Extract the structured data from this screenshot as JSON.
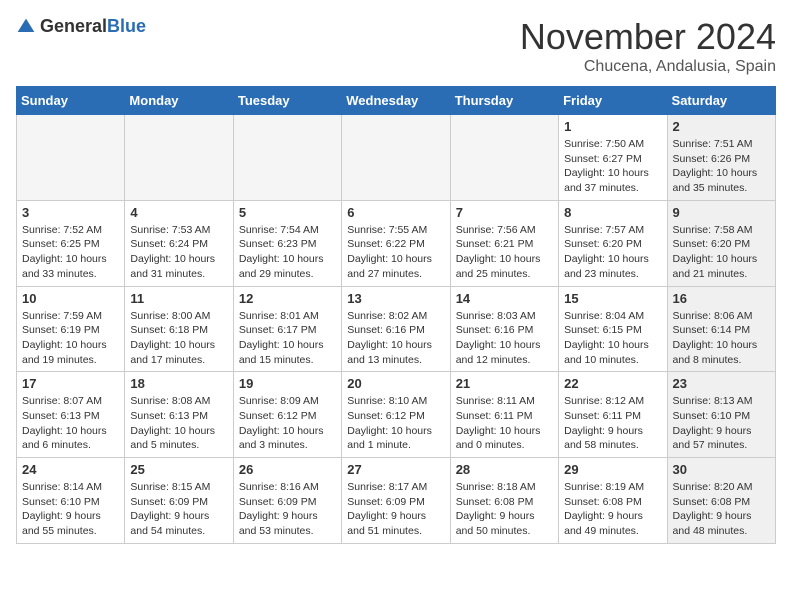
{
  "header": {
    "logo_general": "General",
    "logo_blue": "Blue",
    "month_title": "November 2024",
    "subtitle": "Chucena, Andalusia, Spain"
  },
  "days_of_week": [
    "Sunday",
    "Monday",
    "Tuesday",
    "Wednesday",
    "Thursday",
    "Friday",
    "Saturday"
  ],
  "weeks": [
    [
      {
        "day": "",
        "content": "",
        "empty": true
      },
      {
        "day": "",
        "content": "",
        "empty": true
      },
      {
        "day": "",
        "content": "",
        "empty": true
      },
      {
        "day": "",
        "content": "",
        "empty": true
      },
      {
        "day": "",
        "content": "",
        "empty": true
      },
      {
        "day": "1",
        "content": "Sunrise: 7:50 AM\nSunset: 6:27 PM\nDaylight: 10 hours and 37 minutes.",
        "empty": false,
        "shaded": false
      },
      {
        "day": "2",
        "content": "Sunrise: 7:51 AM\nSunset: 6:26 PM\nDaylight: 10 hours and 35 minutes.",
        "empty": false,
        "shaded": true
      }
    ],
    [
      {
        "day": "3",
        "content": "Sunrise: 7:52 AM\nSunset: 6:25 PM\nDaylight: 10 hours and 33 minutes.",
        "empty": false,
        "shaded": false
      },
      {
        "day": "4",
        "content": "Sunrise: 7:53 AM\nSunset: 6:24 PM\nDaylight: 10 hours and 31 minutes.",
        "empty": false,
        "shaded": false
      },
      {
        "day": "5",
        "content": "Sunrise: 7:54 AM\nSunset: 6:23 PM\nDaylight: 10 hours and 29 minutes.",
        "empty": false,
        "shaded": false
      },
      {
        "day": "6",
        "content": "Sunrise: 7:55 AM\nSunset: 6:22 PM\nDaylight: 10 hours and 27 minutes.",
        "empty": false,
        "shaded": false
      },
      {
        "day": "7",
        "content": "Sunrise: 7:56 AM\nSunset: 6:21 PM\nDaylight: 10 hours and 25 minutes.",
        "empty": false,
        "shaded": false
      },
      {
        "day": "8",
        "content": "Sunrise: 7:57 AM\nSunset: 6:20 PM\nDaylight: 10 hours and 23 minutes.",
        "empty": false,
        "shaded": false
      },
      {
        "day": "9",
        "content": "Sunrise: 7:58 AM\nSunset: 6:20 PM\nDaylight: 10 hours and 21 minutes.",
        "empty": false,
        "shaded": true
      }
    ],
    [
      {
        "day": "10",
        "content": "Sunrise: 7:59 AM\nSunset: 6:19 PM\nDaylight: 10 hours and 19 minutes.",
        "empty": false,
        "shaded": false
      },
      {
        "day": "11",
        "content": "Sunrise: 8:00 AM\nSunset: 6:18 PM\nDaylight: 10 hours and 17 minutes.",
        "empty": false,
        "shaded": false
      },
      {
        "day": "12",
        "content": "Sunrise: 8:01 AM\nSunset: 6:17 PM\nDaylight: 10 hours and 15 minutes.",
        "empty": false,
        "shaded": false
      },
      {
        "day": "13",
        "content": "Sunrise: 8:02 AM\nSunset: 6:16 PM\nDaylight: 10 hours and 13 minutes.",
        "empty": false,
        "shaded": false
      },
      {
        "day": "14",
        "content": "Sunrise: 8:03 AM\nSunset: 6:16 PM\nDaylight: 10 hours and 12 minutes.",
        "empty": false,
        "shaded": false
      },
      {
        "day": "15",
        "content": "Sunrise: 8:04 AM\nSunset: 6:15 PM\nDaylight: 10 hours and 10 minutes.",
        "empty": false,
        "shaded": false
      },
      {
        "day": "16",
        "content": "Sunrise: 8:06 AM\nSunset: 6:14 PM\nDaylight: 10 hours and 8 minutes.",
        "empty": false,
        "shaded": true
      }
    ],
    [
      {
        "day": "17",
        "content": "Sunrise: 8:07 AM\nSunset: 6:13 PM\nDaylight: 10 hours and 6 minutes.",
        "empty": false,
        "shaded": false
      },
      {
        "day": "18",
        "content": "Sunrise: 8:08 AM\nSunset: 6:13 PM\nDaylight: 10 hours and 5 minutes.",
        "empty": false,
        "shaded": false
      },
      {
        "day": "19",
        "content": "Sunrise: 8:09 AM\nSunset: 6:12 PM\nDaylight: 10 hours and 3 minutes.",
        "empty": false,
        "shaded": false
      },
      {
        "day": "20",
        "content": "Sunrise: 8:10 AM\nSunset: 6:12 PM\nDaylight: 10 hours and 1 minute.",
        "empty": false,
        "shaded": false
      },
      {
        "day": "21",
        "content": "Sunrise: 8:11 AM\nSunset: 6:11 PM\nDaylight: 10 hours and 0 minutes.",
        "empty": false,
        "shaded": false
      },
      {
        "day": "22",
        "content": "Sunrise: 8:12 AM\nSunset: 6:11 PM\nDaylight: 9 hours and 58 minutes.",
        "empty": false,
        "shaded": false
      },
      {
        "day": "23",
        "content": "Sunrise: 8:13 AM\nSunset: 6:10 PM\nDaylight: 9 hours and 57 minutes.",
        "empty": false,
        "shaded": true
      }
    ],
    [
      {
        "day": "24",
        "content": "Sunrise: 8:14 AM\nSunset: 6:10 PM\nDaylight: 9 hours and 55 minutes.",
        "empty": false,
        "shaded": false
      },
      {
        "day": "25",
        "content": "Sunrise: 8:15 AM\nSunset: 6:09 PM\nDaylight: 9 hours and 54 minutes.",
        "empty": false,
        "shaded": false
      },
      {
        "day": "26",
        "content": "Sunrise: 8:16 AM\nSunset: 6:09 PM\nDaylight: 9 hours and 53 minutes.",
        "empty": false,
        "shaded": false
      },
      {
        "day": "27",
        "content": "Sunrise: 8:17 AM\nSunset: 6:09 PM\nDaylight: 9 hours and 51 minutes.",
        "empty": false,
        "shaded": false
      },
      {
        "day": "28",
        "content": "Sunrise: 8:18 AM\nSunset: 6:08 PM\nDaylight: 9 hours and 50 minutes.",
        "empty": false,
        "shaded": false
      },
      {
        "day": "29",
        "content": "Sunrise: 8:19 AM\nSunset: 6:08 PM\nDaylight: 9 hours and 49 minutes.",
        "empty": false,
        "shaded": false
      },
      {
        "day": "30",
        "content": "Sunrise: 8:20 AM\nSunset: 6:08 PM\nDaylight: 9 hours and 48 minutes.",
        "empty": false,
        "shaded": true
      }
    ]
  ]
}
